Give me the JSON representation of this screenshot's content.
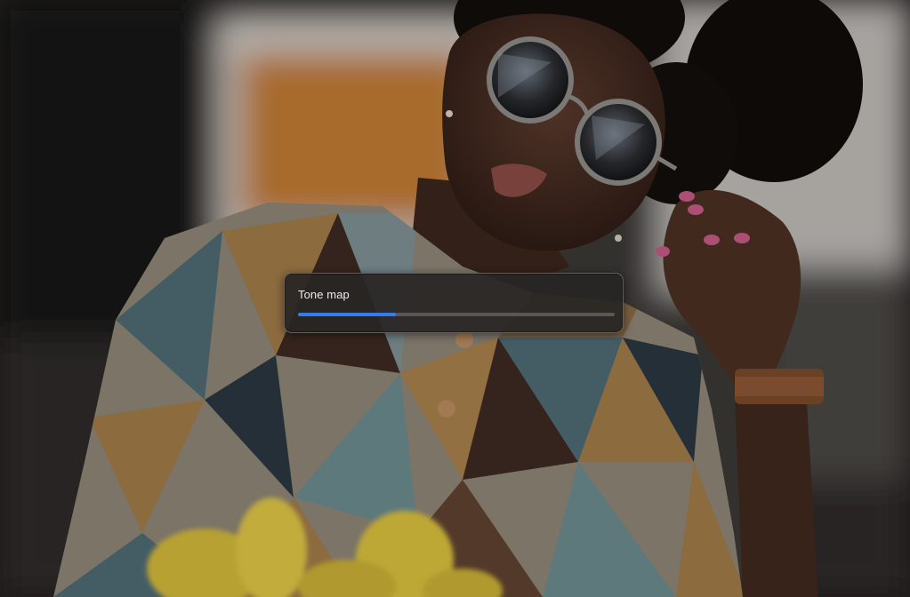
{
  "dialog": {
    "title": "Tone map",
    "progress": 0.31
  },
  "colors": {
    "progress_fill": "#2f7df1",
    "progress_track": "#5a5856",
    "hud_background": "#282624"
  }
}
